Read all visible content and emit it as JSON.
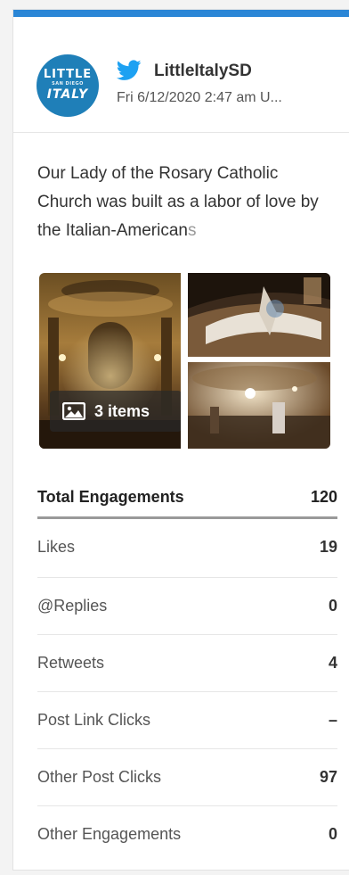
{
  "theme": {
    "accent": "#2a86d6",
    "twitter_blue": "#1da1f2",
    "avatar_bg": "#1f7fb8"
  },
  "post": {
    "avatar": {
      "line1": "LITTLE",
      "line2": "SAN DIEGO",
      "line3": "ITALY"
    },
    "network_icon": "twitter-icon",
    "account": "LittleItalySD",
    "date": "Fri 6/12/2020 2:47 am U...",
    "text_main": "Our Lady of the Rosary Catholic Church was built as a labor of love by the Italian-American",
    "text_fade": "s",
    "media_badge": {
      "icon": "image-icon",
      "label": "3 items"
    }
  },
  "metrics": {
    "total": {
      "label": "Total Engagements",
      "value": "120"
    },
    "rows": [
      {
        "label": "Likes",
        "value": "19"
      },
      {
        "label": "@Replies",
        "value": "0"
      },
      {
        "label": "Retweets",
        "value": "4"
      },
      {
        "label": "Post Link Clicks",
        "value": "–"
      },
      {
        "label": "Other Post Clicks",
        "value": "97"
      },
      {
        "label": "Other Engagements",
        "value": "0"
      }
    ]
  }
}
